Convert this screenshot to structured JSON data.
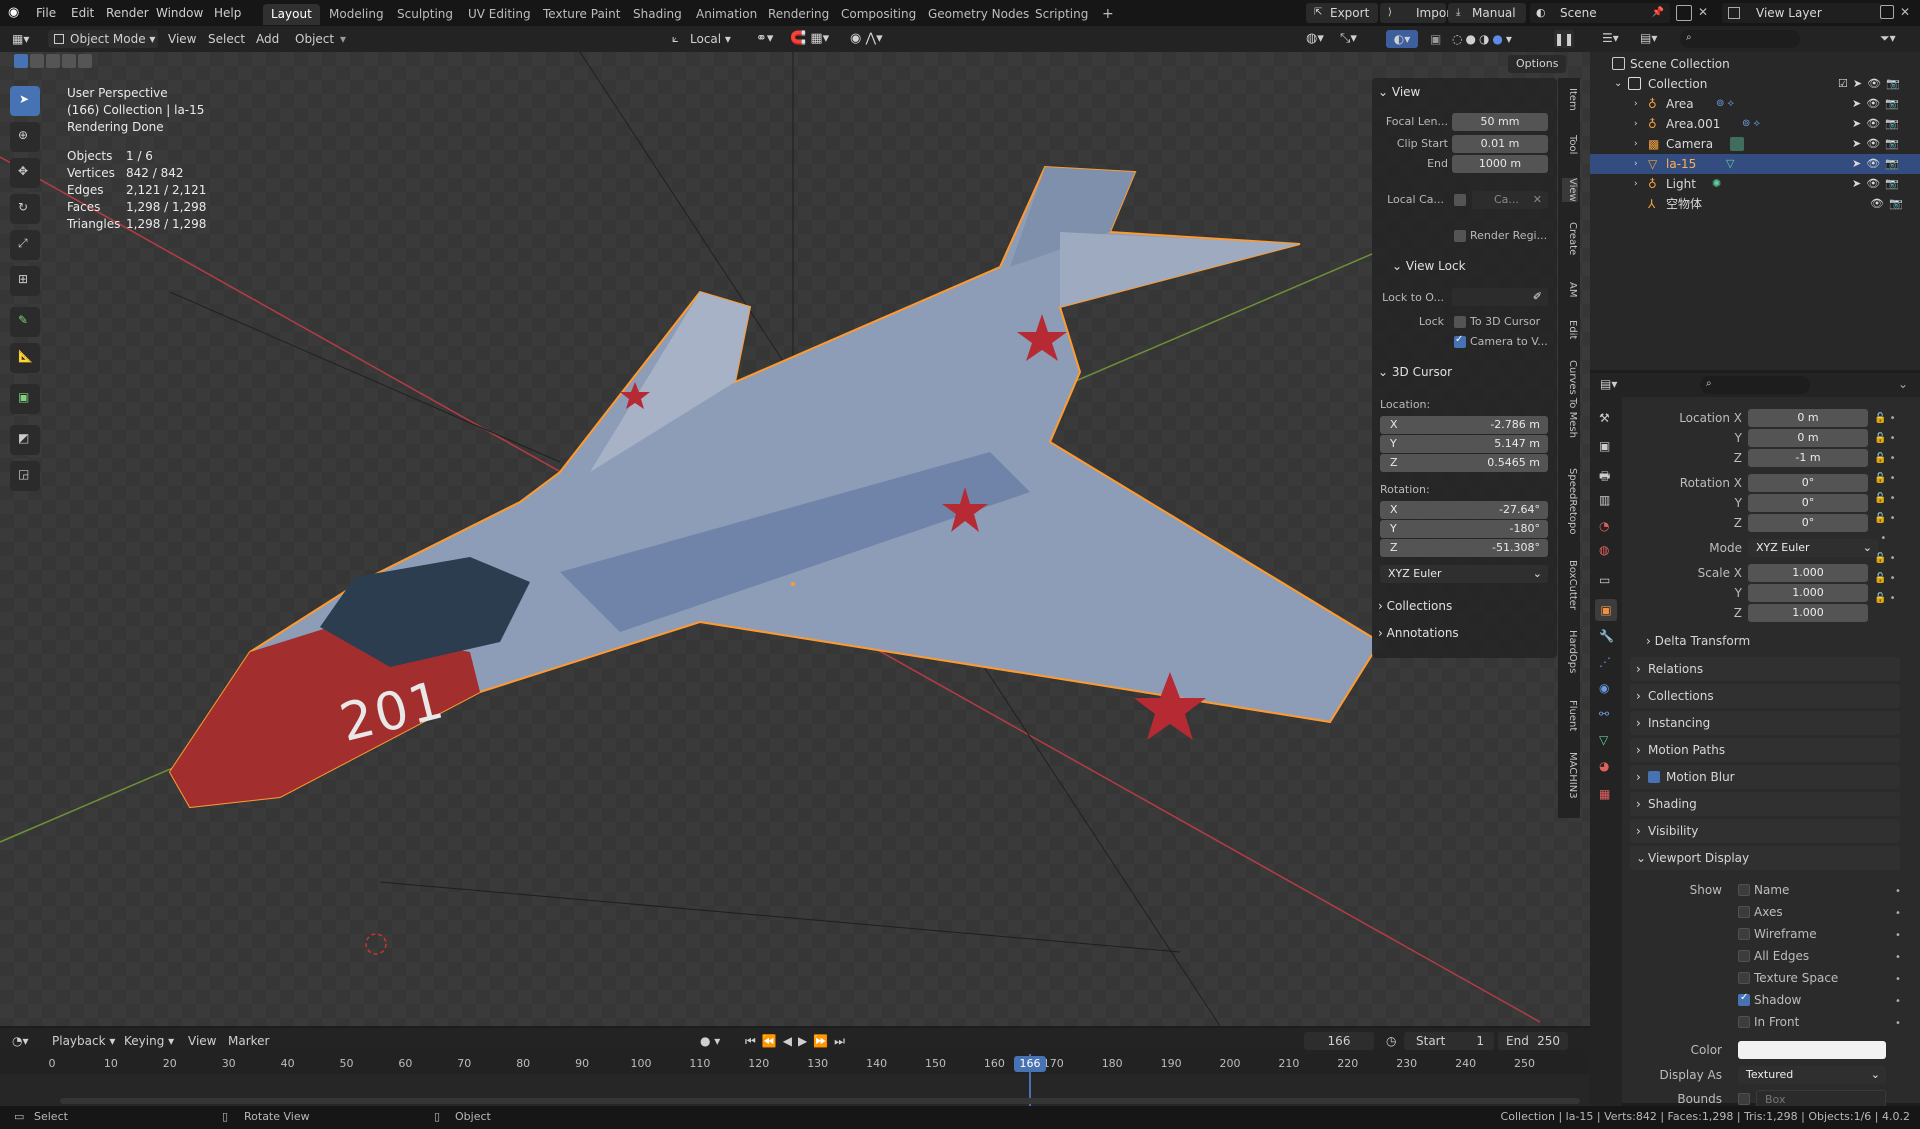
{
  "topbar": {
    "menus": [
      "File",
      "Edit",
      "Render",
      "Window",
      "Help"
    ],
    "workspaces": [
      "Layout",
      "Modeling",
      "Sculpting",
      "UV Editing",
      "Texture Paint",
      "Shading",
      "Animation",
      "Rendering",
      "Compositing",
      "Geometry Nodes",
      "Scripting"
    ],
    "active_workspace": "Layout",
    "add_tab": "+",
    "export": "Export",
    "import": "Import",
    "manual": "Manual",
    "scene": "Scene",
    "view_layer": "View Layer"
  },
  "viewport_header": {
    "mode": "Object Mode",
    "menus": [
      "View",
      "Select",
      "Add",
      "Object"
    ],
    "transform_orientation": "Local",
    "options": "Options"
  },
  "overlay": {
    "perspective": "User Perspective",
    "collection": "(166) Collection | la-15",
    "status": "Rendering Done",
    "stats": [
      {
        "label": "Objects",
        "value": "1 / 6"
      },
      {
        "label": "Vertices",
        "value": "842 / 842"
      },
      {
        "label": "Edges",
        "value": "2,121 / 2,121"
      },
      {
        "label": "Faces",
        "value": "1,298 / 1,298"
      },
      {
        "label": "Triangles",
        "value": "1,298 / 1,298"
      }
    ],
    "model_number": "201"
  },
  "npanel": {
    "view_title": "View",
    "focal_label": "Focal Len...",
    "focal_value": "50 mm",
    "clip_start_label": "Clip Start",
    "clip_start_value": "0.01 m",
    "end_label": "End",
    "end_value": "1000 m",
    "local_cam_label": "Local Ca...",
    "local_cam_value": "Ca...",
    "render_region": "Render Regi...",
    "view_lock_title": "View Lock",
    "lock_to_label": "Lock to O...",
    "lock_label": "Lock",
    "to_3d_cursor": "To 3D Cursor",
    "camera_to_view": "Camera to V...",
    "cursor_title": "3D Cursor",
    "location_label": "Location:",
    "loc": [
      {
        "axis": "X",
        "value": "-2.786 m"
      },
      {
        "axis": "Y",
        "value": "5.147 m"
      },
      {
        "axis": "Z",
        "value": "0.5465 m"
      }
    ],
    "rotation_label": "Rotation:",
    "rot": [
      {
        "axis": "X",
        "value": "-27.64°"
      },
      {
        "axis": "Y",
        "value": "-180°"
      },
      {
        "axis": "Z",
        "value": "-51.308°"
      }
    ],
    "rotation_mode": "XYZ Euler",
    "collections": "Collections",
    "annotations": "Annotations",
    "side_tabs": [
      "Item",
      "Tool",
      "View",
      "Create",
      "AM",
      "Edit",
      "Curves To Mesh",
      "SpeedRetopo",
      "BoxCutter",
      "HardOps",
      "Fluent",
      "MACHIN3"
    ]
  },
  "outliner": {
    "root": "Scene Collection",
    "collection": "Collection",
    "items": [
      "Area",
      "Area.001",
      "Camera",
      "la-15",
      "Light",
      "空物体"
    ],
    "selected": "la-15"
  },
  "properties": {
    "location_x_label": "Location X",
    "location_x": "0 m",
    "location_y_label": "Y",
    "location_y": "0 m",
    "location_z_label": "Z",
    "location_z": "-1 m",
    "rotation_x_label": "Rotation X",
    "rotation_x": "0°",
    "rotation_y_label": "Y",
    "rotation_y": "0°",
    "rotation_z_label": "Z",
    "rotation_z": "0°",
    "mode_label": "Mode",
    "mode_value": "XYZ Euler",
    "scale_x_label": "Scale X",
    "scale_x": "1.000",
    "scale_y_label": "Y",
    "scale_y": "1.000",
    "scale_z_label": "Z",
    "scale_z": "1.000",
    "delta_transform": "Delta Transform",
    "sections": [
      "Relations",
      "Collections",
      "Instancing",
      "Motion Paths",
      "Motion Blur",
      "Shading",
      "Visibility"
    ],
    "viewport_display": "Viewport Display",
    "show_label": "Show",
    "show_items": [
      {
        "label": "Name",
        "checked": false
      },
      {
        "label": "Axes",
        "checked": false
      },
      {
        "label": "Wireframe",
        "checked": false
      },
      {
        "label": "All Edges",
        "checked": false
      },
      {
        "label": "Texture Space",
        "checked": false
      },
      {
        "label": "Shadow",
        "checked": true
      },
      {
        "label": "In Front",
        "checked": false
      }
    ],
    "color_label": "Color",
    "display_as_label": "Display As",
    "display_as_value": "Textured",
    "bounds_label": "Bounds",
    "bounds_value": "Box"
  },
  "timeline": {
    "menus": [
      "Playback",
      "Keying",
      "View",
      "Marker"
    ],
    "current_frame": "166",
    "start_label": "Start",
    "start_value": "1",
    "end_label": "End",
    "end_value": "250",
    "ticks": [
      "0",
      "10",
      "20",
      "30",
      "40",
      "50",
      "60",
      "70",
      "80",
      "90",
      "100",
      "110",
      "120",
      "130",
      "140",
      "150",
      "160",
      "170",
      "180",
      "190",
      "200",
      "210",
      "220",
      "230",
      "240",
      "250"
    ]
  },
  "statusbar": {
    "select": "Select",
    "rotate_view": "Rotate View",
    "object": "Object",
    "info": "Collection | la-15 | Verts:842 | Faces:1,298 | Tris:1,298 | Objects:1/6 | 4.0.2"
  }
}
